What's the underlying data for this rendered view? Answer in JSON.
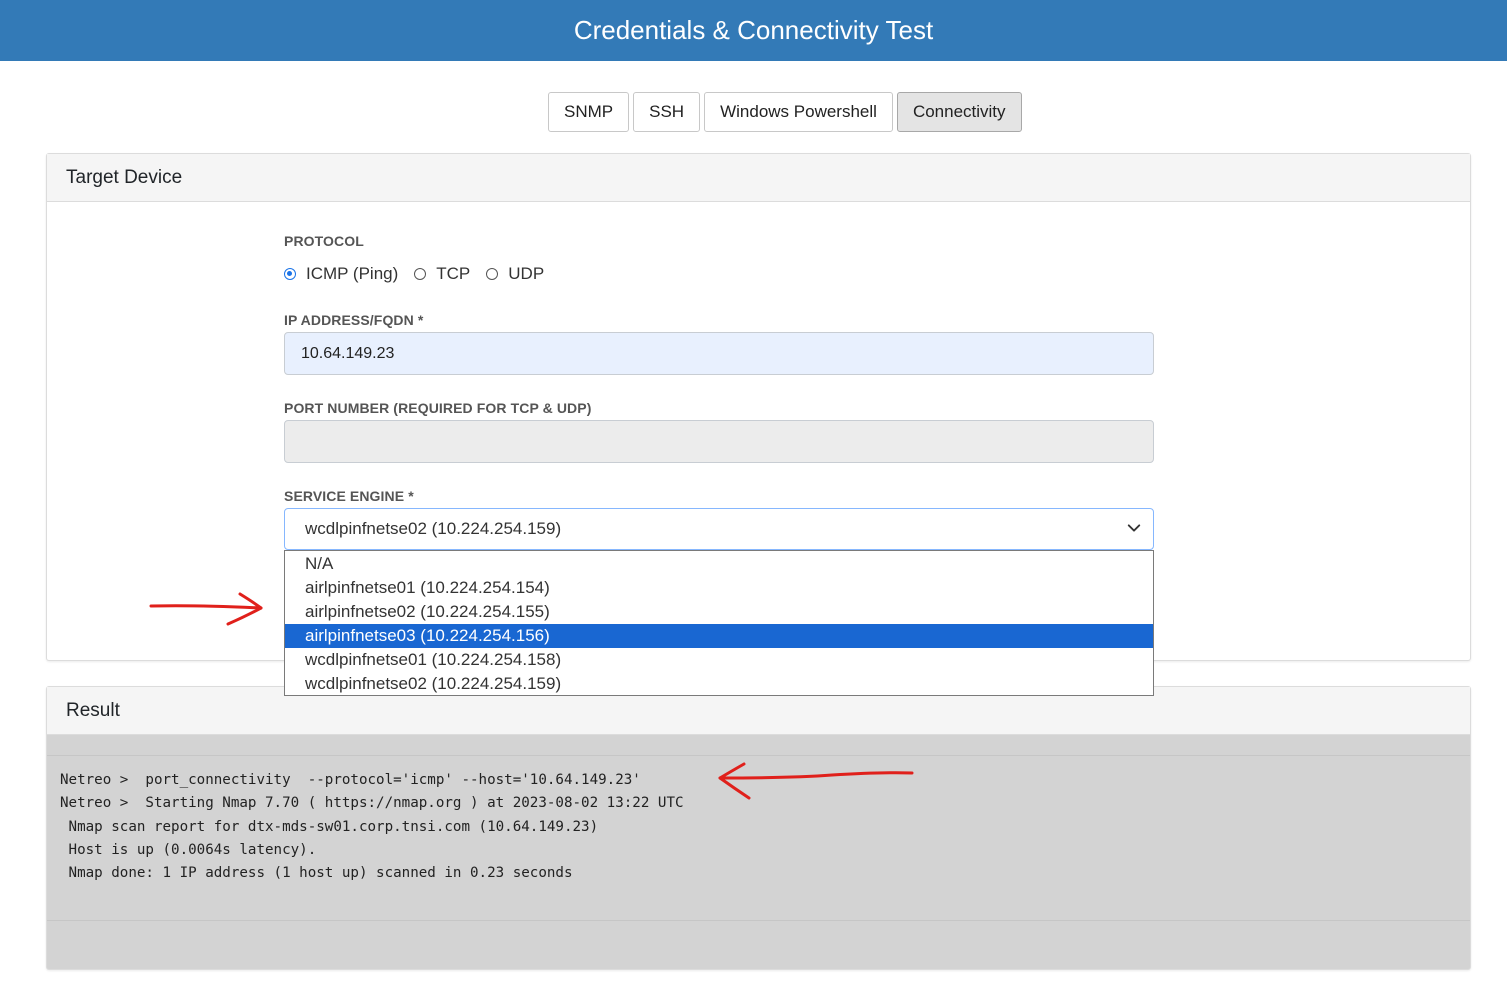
{
  "header": {
    "title": "Credentials & Connectivity Test"
  },
  "tabs": [
    {
      "label": "SNMP",
      "active": false
    },
    {
      "label": "SSH",
      "active": false
    },
    {
      "label": "Windows Powershell",
      "active": false
    },
    {
      "label": "Connectivity",
      "active": true
    }
  ],
  "target": {
    "title": "Target Device",
    "protocol_label": "PROTOCOL",
    "protocols": [
      {
        "label": "ICMP (Ping)",
        "checked": true
      },
      {
        "label": "TCP",
        "checked": false
      },
      {
        "label": "UDP",
        "checked": false
      }
    ],
    "ip_label": "IP ADDRESS/FQDN",
    "ip_value": "10.64.149.23",
    "port_label": "PORT NUMBER (REQUIRED FOR TCP & UDP)",
    "port_value": "",
    "engine_label": "SERVICE ENGINE",
    "required_mark": "*",
    "engine_selected": "wcdlpinfnetse02 (10.224.254.159)",
    "engine_options": [
      "N/A",
      "airlpinfnetse01 (10.224.254.154)",
      "airlpinfnetse02 (10.224.254.155)",
      "airlpinfnetse03 (10.224.254.156)",
      "wcdlpinfnetse01 (10.224.254.158)",
      "wcdlpinfnetse02 (10.224.254.159)"
    ],
    "engine_highlighted": "airlpinfnetse03 (10.224.254.156)"
  },
  "result": {
    "title": "Result",
    "lines": [
      "Netreo >  port_connectivity  --protocol='icmp' --host='10.64.149.23'",
      "Netreo >  Starting Nmap 7.70 ( https://nmap.org ) at 2023-08-02 13:22 UTC",
      " Nmap scan report for dtx-mds-sw01.corp.tnsi.com (10.64.149.23)",
      " Host is up (0.0064s latency).",
      " Nmap done: 1 IP address (1 host up) scanned in 0.23 seconds"
    ]
  },
  "colors": {
    "brand": "#337ab7",
    "highlight": "#1967d2",
    "annotation": "#e0201b"
  }
}
